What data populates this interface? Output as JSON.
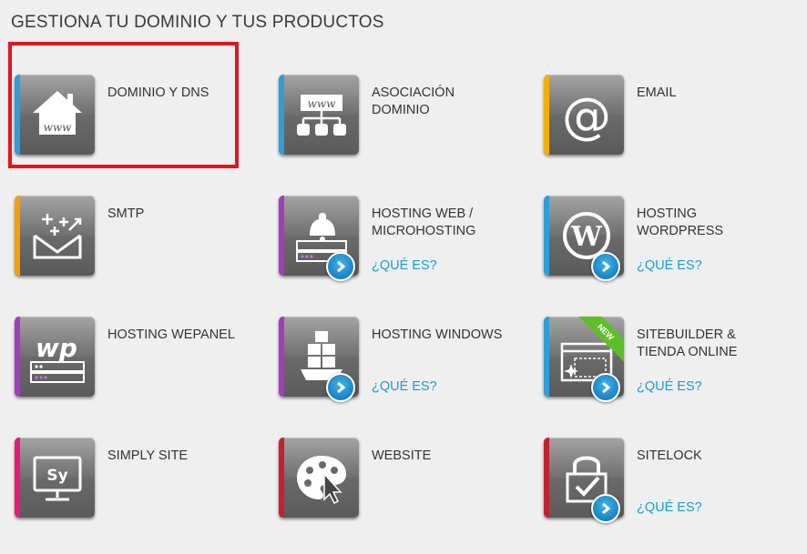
{
  "page": {
    "title": "GESTIONA TU DOMINIO Y TUS PRODUCTOS"
  },
  "link_text": "¿QUÉ ES?",
  "products": [
    {
      "id": "dominio-dns",
      "label_1": "DOMINIO Y DNS",
      "label_2": "",
      "accent": "#2f9ed8",
      "icon": "house-www-icon",
      "info": false
    },
    {
      "id": "asociacion-dominio",
      "label_1": "ASOCIACIÓN",
      "label_2": "DOMINIO",
      "accent": "#2f9ed8",
      "icon": "www-network-icon",
      "info": false
    },
    {
      "id": "email",
      "label_1": "EMAIL",
      "label_2": "",
      "accent": "#f2b000",
      "icon": "at-sign-icon",
      "info": false
    },
    {
      "id": "smtp",
      "label_1": "SMTP",
      "label_2": "",
      "accent": "#f5a000",
      "icon": "envelope-sparkle-icon",
      "info": false
    },
    {
      "id": "hosting-web",
      "label_1": "HOSTING WEB /",
      "label_2": "MICROHOSTING",
      "accent": "#a23cbe",
      "icon": "server-bell-icon",
      "info": true
    },
    {
      "id": "hosting-wordpress",
      "label_1": "HOSTING",
      "label_2": "WORDPRESS",
      "accent": "#2f9ed8",
      "icon": "wordpress-icon",
      "info": true
    },
    {
      "id": "hosting-wepanel",
      "label_1": "HOSTING WEPANEL",
      "label_2": "",
      "accent": "#a23cbe",
      "icon": "wp-panel-icon",
      "info": false
    },
    {
      "id": "hosting-windows",
      "label_1": "HOSTING WINDOWS",
      "label_2": "",
      "accent": "#a23cbe",
      "icon": "stacked-boxes-icon",
      "info": true
    },
    {
      "id": "sitebuilder",
      "label_1": "SITEBUILDER &",
      "label_2": "TIENDA ONLINE",
      "accent": "#2f9ed8",
      "icon": "browser-window-icon",
      "info": true,
      "badge": "NEW"
    },
    {
      "id": "simply-site",
      "label_1": "SIMPLY SITE",
      "label_2": "",
      "accent": "#e6187c",
      "icon": "monitor-sy-icon",
      "info": false
    },
    {
      "id": "website",
      "label_1": "WEBSITE",
      "label_2": "",
      "accent": "#c42030",
      "icon": "palette-cursor-icon",
      "info": false
    },
    {
      "id": "sitelock",
      "label_1": "SITELOCK",
      "label_2": "",
      "accent": "#c42030",
      "icon": "padlock-check-icon",
      "info": true
    }
  ],
  "colors": {
    "highlight": "#e3141d",
    "link": "#1c9ad6",
    "badge": "#5fbf2a"
  }
}
